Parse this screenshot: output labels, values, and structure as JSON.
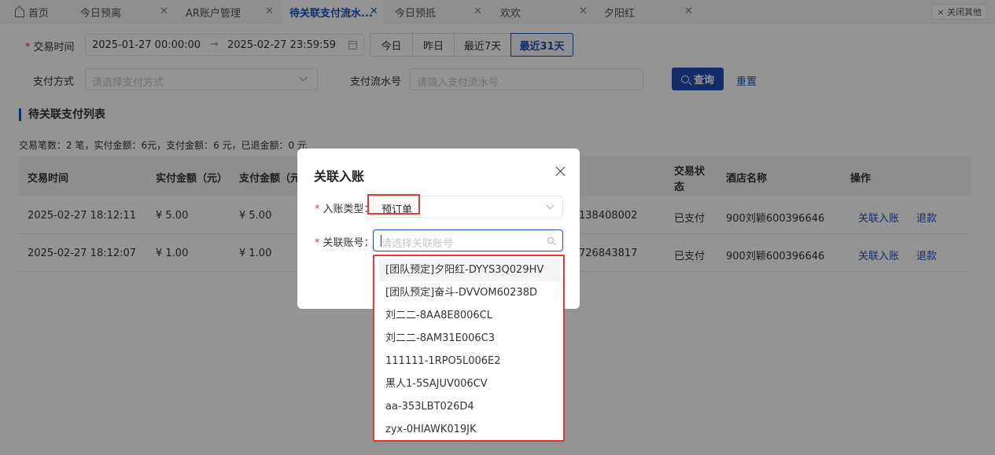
{
  "tabs": {
    "home": "首页",
    "items": [
      {
        "label": "今日预离",
        "active": false
      },
      {
        "label": "AR账户管理",
        "active": false
      },
      {
        "label": "待关联支付流水...",
        "active": true
      },
      {
        "label": "今日预抵",
        "active": false
      },
      {
        "label": "欢欢",
        "active": false
      },
      {
        "label": "夕阳红",
        "active": false
      }
    ],
    "close_others": "× 关闭其他"
  },
  "filters": {
    "trade_time_label": "交易时间",
    "start": "2025-01-27 00:00:00",
    "arrow": "→",
    "end": "2025-02-27 23:59:59",
    "quick": [
      "今日",
      "昨日",
      "最近7天",
      "最近31天"
    ],
    "pay_method_label": "支付方式",
    "pay_method_placeholder": "请选择支付方式",
    "serial_label": "支付流水号",
    "serial_placeholder": "请输入支付流水号",
    "search_button": "查询",
    "reset_link": "重置"
  },
  "list": {
    "title": "待关联支付列表",
    "summary": "交易笔数：2 笔，实付金额：6元，支付金额：6 元，已退金额：0 元",
    "headers": {
      "time": "交易时间",
      "paid": "实付金额（元）",
      "amount": "支付金额（元",
      "status_l1": "交易状",
      "status_l2": "态",
      "hotel": "酒店名称",
      "ops": "操作"
    },
    "rows": [
      {
        "time": "2025-02-27 18:12:11",
        "paid": "¥ 5.00",
        "amount": "¥ 5.00",
        "serial": "138408002",
        "status": "已支付",
        "hotel": "900刘颖600396646",
        "link": "关联入账",
        "refund": "退款"
      },
      {
        "time": "2025-02-27 18:12:07",
        "paid": "¥ 1.00",
        "amount": "¥ 1.00",
        "serial": "726843817",
        "status": "已支付",
        "hotel": "900刘颖600396646",
        "link": "关联入账",
        "refund": "退款"
      }
    ]
  },
  "modal": {
    "title": "关联入账",
    "entry_type_label": "入账类型：",
    "entry_type_value": "预订单",
    "account_label": "关联账号：",
    "account_placeholder": "请选择关联账号",
    "options": [
      "[团队预定]夕阳红-DYYS3Q029HV",
      "[团队预定]奋斗-DVVOM60238D",
      "刘二二-8AA8E8006CL",
      "刘二二-8AM31E006C3",
      "111111-1RPO5L006E2",
      "黑人1-5SAJUV006CV",
      "aa-353LBT026D4",
      "zyx-0HIAWK019JK"
    ]
  }
}
